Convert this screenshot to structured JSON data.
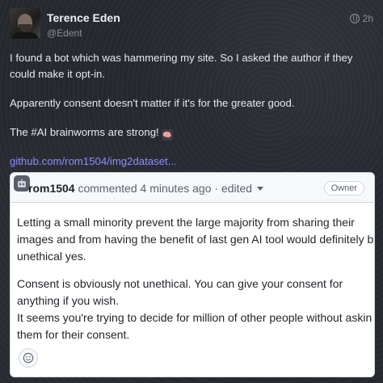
{
  "post": {
    "display_name": "Terence Eden",
    "handle": "@Edent",
    "time": "2h",
    "paragraphs": [
      "I found a bot which was hammering my site. So I asked the author if they could make it opt-in.",
      "Apparently consent doesn't matter if it's for the greater good.",
      "The #AI brainworms are strong!"
    ],
    "link_text": "github.com/rom1504/img2dataset..."
  },
  "comment": {
    "user": "rom1504",
    "action": "commented",
    "time": "4 minutes ago",
    "edited": "edited",
    "badge": "Owner",
    "lines_p1": [
      "Letting a small minority prevent the large majority from sharing their",
      "images and from having the benefit of last gen AI tool would definitely b",
      "unethical yes."
    ],
    "lines_p2": [
      "Consent is obviously not unethical. You can give your consent for",
      "anything if you wish.",
      "It seems you're trying to decide for million of other people without askin",
      "them for their consent."
    ]
  },
  "icons": {
    "visibility": "globe-icon",
    "reaction": "smiley-icon",
    "emoji": "brain-emoji"
  }
}
